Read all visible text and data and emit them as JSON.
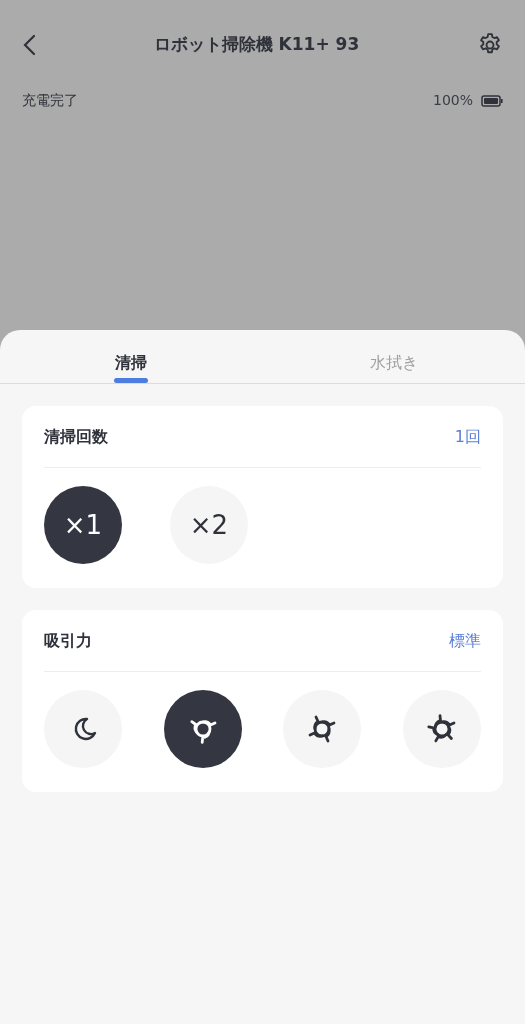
{
  "header": {
    "title": "ロボット掃除機 K11+ 93"
  },
  "status": {
    "label": "充電完了",
    "battery": "100%"
  },
  "tabs": [
    {
      "label": "清掃",
      "selected": true
    },
    {
      "label": "水拭き",
      "selected": false
    }
  ],
  "cards": [
    {
      "title": "清掃回数",
      "value": "1回",
      "options": [
        {
          "kind": "text",
          "label": "×1",
          "selected": true
        },
        {
          "kind": "text",
          "label": "×2",
          "selected": false
        }
      ]
    },
    {
      "title": "吸引力",
      "value": "標準",
      "options": [
        {
          "kind": "quiet",
          "selected": false
        },
        {
          "kind": "standard",
          "selected": true
        },
        {
          "kind": "strong",
          "selected": false
        },
        {
          "kind": "max",
          "selected": false
        }
      ]
    }
  ]
}
